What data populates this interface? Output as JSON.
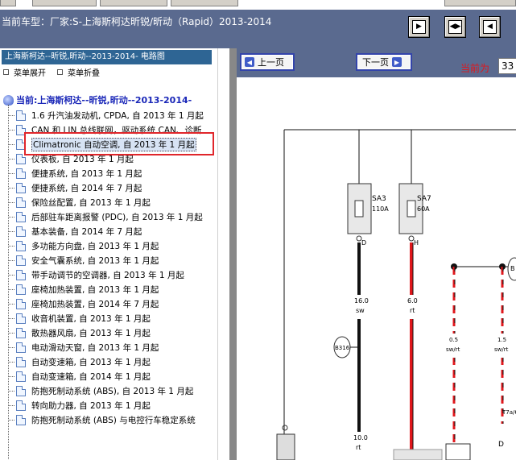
{
  "header": {
    "title": "当前车型：厂家:S-上海斯柯达昕锐/昕动（Rapid）2013-2014",
    "buttons": [
      {
        "name": "first-page",
        "glyph": "▶"
      },
      {
        "name": "double-page",
        "glyph": "◀▶"
      },
      {
        "name": "last-page",
        "glyph": "◀"
      }
    ]
  },
  "tree": {
    "panel_title": "上海斯柯达--昕锐,昕动--2013-2014- 电路图",
    "expand_label": "菜单展开",
    "collapse_label": "菜单折叠",
    "root_label": "当前:上海斯柯达--昕锐,昕动--2013-2014-",
    "items": [
      {
        "label": "1.6 升汽油发动机, CPDA, 自 2013 年 1 月起"
      },
      {
        "label": "CAN 和 LIN 总线联网，驱动系统 CAN、诊断"
      },
      {
        "label": "Climatronic 自动空调, 自 2013 年 1 月起"
      },
      {
        "label": "仪表板, 自 2013 年 1 月起"
      },
      {
        "label": "便捷系统, 自 2013 年 1 月起"
      },
      {
        "label": "便捷系统, 自 2014 年 7 月起"
      },
      {
        "label": "保险丝配置, 自 2013 年 1 月起"
      },
      {
        "label": "后部驻车距离报警 (PDC), 自 2013 年 1 月起"
      },
      {
        "label": "基本装备, 自 2014 年 7 月起"
      },
      {
        "label": "多功能方向盘, 自 2013 年 1 月起"
      },
      {
        "label": "安全气囊系统, 自 2013 年 1 月起"
      },
      {
        "label": "带手动调节的空调器, 自 2013 年 1 月起"
      },
      {
        "label": "座椅加热装置, 自 2013 年 1 月起"
      },
      {
        "label": "座椅加热装置, 自 2014 年 7 月起"
      },
      {
        "label": "收音机装置, 自 2013 年 1 月起"
      },
      {
        "label": "散热器风扇, 自 2013 年 1 月起"
      },
      {
        "label": "电动滑动天窗, 自 2013 年 1 月起"
      },
      {
        "label": "自动变速箱, 自 2013 年 1 月起"
      },
      {
        "label": "自动变速箱, 自 2014 年 1 月起"
      },
      {
        "label": "防抱死制动系统 (ABS), 自 2013 年 1 月起"
      },
      {
        "label": "转向助力器, 自 2013 年 1 月起"
      },
      {
        "label": "防抱死制动系统 (ABS) 与电控行车稳定系统"
      }
    ]
  },
  "nav": {
    "prev_label": "上一页",
    "next_label": "下一页",
    "current_label": "当前为",
    "current_page": "33"
  },
  "diagram": {
    "fuse1_name": "SA3",
    "fuse1_rating": "110A",
    "fuse2_name": "SA7",
    "fuse2_rating": "60A",
    "pin1": "D",
    "pin2": "H",
    "wire1_size": "16.0",
    "wire1_color": "sw",
    "wire2_size": "6.0",
    "wire2_color": "rt",
    "wire3_size": "0.5",
    "wire3_color": "sw/rt",
    "wire4_size": "1.5",
    "wire4_color": "sw/rt",
    "conn_b": "B316",
    "conn_b_right": "B",
    "bottom_size": "10.0",
    "bottom_color": "rt",
    "right_tag": "T7a/6",
    "bottom_pin": "D",
    "colors": {
      "red": "#e0161b",
      "black": "#111111"
    }
  }
}
